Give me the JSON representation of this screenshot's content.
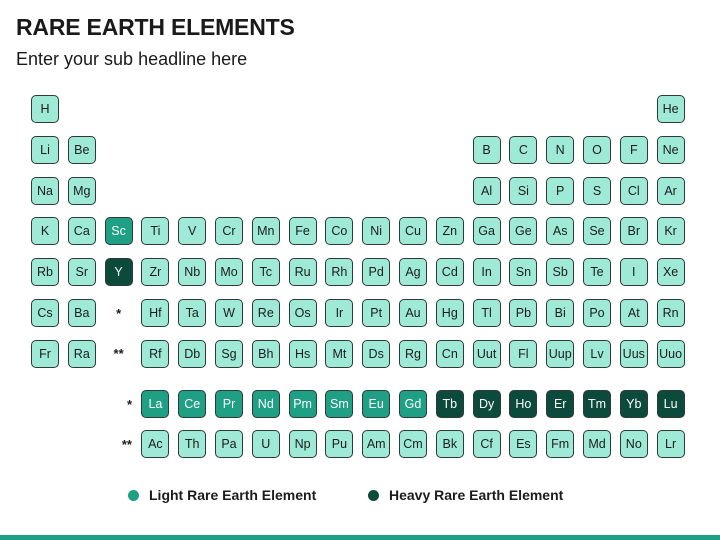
{
  "header": {
    "title": "RARE EARTH ELEMENTS",
    "subtitle": "Enter your sub headline here"
  },
  "colors": {
    "standard": "#9eead6",
    "light_rare_earth": "#1f9f84",
    "heavy_rare_earth": "#0c4a3c",
    "border": "#2f3a36",
    "accent_bar": "#1f9f84"
  },
  "periodic_table": {
    "rows": [
      [
        [
          "H",
          "n"
        ],
        null,
        null,
        null,
        null,
        null,
        null,
        null,
        null,
        null,
        null,
        null,
        null,
        null,
        null,
        null,
        null,
        [
          "He",
          "n"
        ]
      ],
      [
        [
          "Li",
          "n"
        ],
        [
          "Be",
          "n"
        ],
        null,
        null,
        null,
        null,
        null,
        null,
        null,
        null,
        null,
        null,
        [
          "B",
          "n"
        ],
        [
          "C",
          "n"
        ],
        [
          "N",
          "n"
        ],
        [
          "O",
          "n"
        ],
        [
          "F",
          "n"
        ],
        [
          "Ne",
          "n"
        ]
      ],
      [
        [
          "Na",
          "n"
        ],
        [
          "Mg",
          "n"
        ],
        null,
        null,
        null,
        null,
        null,
        null,
        null,
        null,
        null,
        null,
        [
          "Al",
          "n"
        ],
        [
          "Si",
          "n"
        ],
        [
          "P",
          "n"
        ],
        [
          "S",
          "n"
        ],
        [
          "Cl",
          "n"
        ],
        [
          "Ar",
          "n"
        ]
      ],
      [
        [
          "K",
          "n"
        ],
        [
          "Ca",
          "n"
        ],
        [
          "Sc",
          "l"
        ],
        [
          "Ti",
          "n"
        ],
        [
          "V",
          "n"
        ],
        [
          "Cr",
          "n"
        ],
        [
          "Mn",
          "n"
        ],
        [
          "Fe",
          "n"
        ],
        [
          "Co",
          "n"
        ],
        [
          "Ni",
          "n"
        ],
        [
          "Cu",
          "n"
        ],
        [
          "Zn",
          "n"
        ],
        [
          "Ga",
          "n"
        ],
        [
          "Ge",
          "n"
        ],
        [
          "As",
          "n"
        ],
        [
          "Se",
          "n"
        ],
        [
          "Br",
          "n"
        ],
        [
          "Kr",
          "n"
        ]
      ],
      [
        [
          "Rb",
          "n"
        ],
        [
          "Sr",
          "n"
        ],
        [
          "Y",
          "h"
        ],
        [
          "Zr",
          "n"
        ],
        [
          "Nb",
          "n"
        ],
        [
          "Mo",
          "n"
        ],
        [
          "Tc",
          "n"
        ],
        [
          "Ru",
          "n"
        ],
        [
          "Rh",
          "n"
        ],
        [
          "Pd",
          "n"
        ],
        [
          "Ag",
          "n"
        ],
        [
          "Cd",
          "n"
        ],
        [
          "In",
          "n"
        ],
        [
          "Sn",
          "n"
        ],
        [
          "Sb",
          "n"
        ],
        [
          "Te",
          "n"
        ],
        [
          "I",
          "n"
        ],
        [
          "Xe",
          "n"
        ]
      ],
      [
        [
          "Cs",
          "n"
        ],
        [
          "Ba",
          "n"
        ],
        [
          "*",
          "n"
        ],
        [
          "Hf",
          "n"
        ],
        [
          "Ta",
          "n"
        ],
        [
          "W",
          "n"
        ],
        [
          "Re",
          "n"
        ],
        [
          "Os",
          "n"
        ],
        [
          "Ir",
          "n"
        ],
        [
          "Pt",
          "n"
        ],
        [
          "Au",
          "n"
        ],
        [
          "Hg",
          "n"
        ],
        [
          "Tl",
          "n"
        ],
        [
          "Pb",
          "n"
        ],
        [
          "Bi",
          "n"
        ],
        [
          "Po",
          "n"
        ],
        [
          "At",
          "n"
        ],
        [
          "Rn",
          "n"
        ]
      ],
      [
        [
          "Fr",
          "n"
        ],
        [
          "Ra",
          "n"
        ],
        [
          "**",
          "n"
        ],
        [
          "Rf",
          "n"
        ],
        [
          "Db",
          "n"
        ],
        [
          "Sg",
          "n"
        ],
        [
          "Bh",
          "n"
        ],
        [
          "Hs",
          "n"
        ],
        [
          "Mt",
          "n"
        ],
        [
          "Ds",
          "n"
        ],
        [
          "Rg",
          "n"
        ],
        [
          "Cn",
          "n"
        ],
        [
          "Uut",
          "n"
        ],
        [
          "Fl",
          "n"
        ],
        [
          "Uup",
          "n"
        ],
        [
          "Lv",
          "n"
        ],
        [
          "Uus",
          "n"
        ],
        [
          "Uuo",
          "n"
        ]
      ]
    ],
    "series": [
      {
        "label": "*",
        "elements": [
          [
            "La",
            "l"
          ],
          [
            "Ce",
            "l"
          ],
          [
            "Pr",
            "l"
          ],
          [
            "Nd",
            "l"
          ],
          [
            "Pm",
            "l"
          ],
          [
            "Sm",
            "l"
          ],
          [
            "Eu",
            "l"
          ],
          [
            "Gd",
            "l"
          ],
          [
            "Tb",
            "h"
          ],
          [
            "Dy",
            "h"
          ],
          [
            "Ho",
            "h"
          ],
          [
            "Er",
            "h"
          ],
          [
            "Tm",
            "h"
          ],
          [
            "Yb",
            "h"
          ],
          [
            "Lu",
            "h"
          ]
        ]
      },
      {
        "label": "**",
        "elements": [
          [
            "Ac",
            "n"
          ],
          [
            "Th",
            "n"
          ],
          [
            "Pa",
            "n"
          ],
          [
            "U",
            "n"
          ],
          [
            "Np",
            "n"
          ],
          [
            "Pu",
            "n"
          ],
          [
            "Am",
            "n"
          ],
          [
            "Cm",
            "n"
          ],
          [
            "Bk",
            "n"
          ],
          [
            "Cf",
            "n"
          ],
          [
            "Es",
            "n"
          ],
          [
            "Fm",
            "n"
          ],
          [
            "Md",
            "n"
          ],
          [
            "No",
            "n"
          ],
          [
            "Lr",
            "n"
          ]
        ]
      }
    ]
  },
  "legend": {
    "light_label": "Light Rare Earth Element",
    "heavy_label": "Heavy Rare Earth Element"
  }
}
